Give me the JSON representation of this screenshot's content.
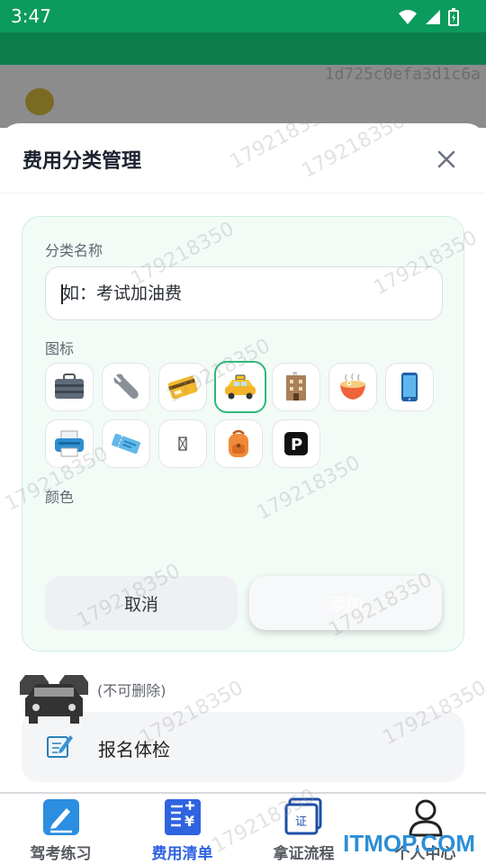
{
  "status_bar": {
    "time": "3:47"
  },
  "background": {
    "id_text": "1d725c0efa3d1c6a"
  },
  "sheet": {
    "title": "费用分类管理",
    "form": {
      "name_label": "分类名称",
      "name_placeholder": "如：考试加油费",
      "icon_label": "图标",
      "icons": [
        "briefcase",
        "wrench",
        "credit-card",
        "taxi",
        "hotel",
        "noodles",
        "mobile-phone",
        "printer",
        "ticket",
        "missing-glyph",
        "backpack",
        "parking"
      ],
      "selected_icon": "taxi",
      "color_label": "颜色",
      "cancel_label": "取消",
      "add_label": "添加"
    },
    "system_section_label": "(不可删除)",
    "system_items": [
      {
        "label": "报名体检",
        "icon": "memo-icon"
      }
    ]
  },
  "bottom_nav": [
    {
      "label": "驾考练习",
      "icon": "pen-icon",
      "active": false
    },
    {
      "label": "费用清单",
      "icon": "receipt-icon",
      "active": true
    },
    {
      "label": "拿证流程",
      "icon": "certificate-icon",
      "active": false
    },
    {
      "label": "个人中心",
      "icon": "person-icon",
      "active": false
    }
  ],
  "watermark": "179218350",
  "brand": "ITMOP.COM",
  "colors": {
    "accent_green": "#2fb87a",
    "nav_active": "#2f63e0",
    "status_bar": "#0b9b5c"
  }
}
